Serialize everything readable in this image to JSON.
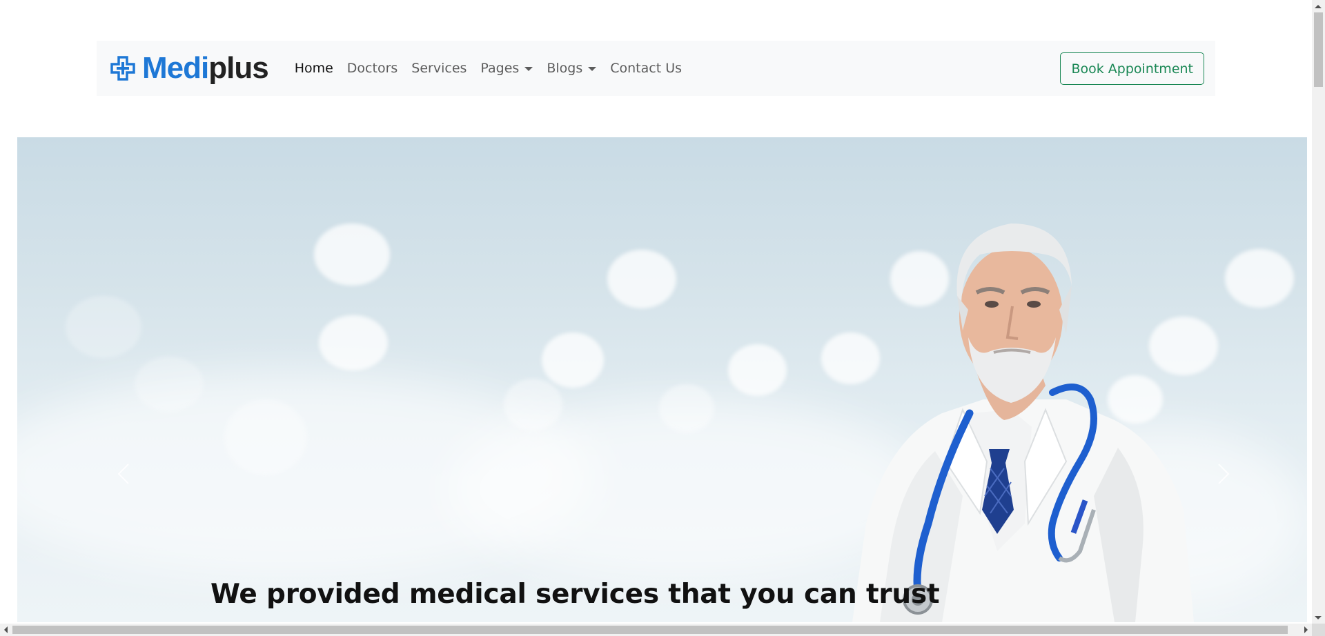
{
  "brand": {
    "name_part1": "Medi",
    "name_part2": "plus",
    "icon": "medical-cross-icon",
    "color_primary": "#1e78d6",
    "color_dark": "#222222"
  },
  "nav": {
    "items": [
      {
        "label": "Home",
        "active": true,
        "dropdown": false
      },
      {
        "label": "Doctors",
        "active": false,
        "dropdown": false
      },
      {
        "label": "Services",
        "active": false,
        "dropdown": false
      },
      {
        "label": "Pages",
        "active": false,
        "dropdown": true
      },
      {
        "label": "Blogs",
        "active": false,
        "dropdown": true
      },
      {
        "label": "Contact Us",
        "active": false,
        "dropdown": false
      }
    ],
    "cta_label": "Book Appointment",
    "cta_color": "#198754"
  },
  "hero": {
    "caption": "We provided medical services that you can trust",
    "prev_icon": "chevron-left-icon",
    "next_icon": "chevron-right-icon"
  }
}
